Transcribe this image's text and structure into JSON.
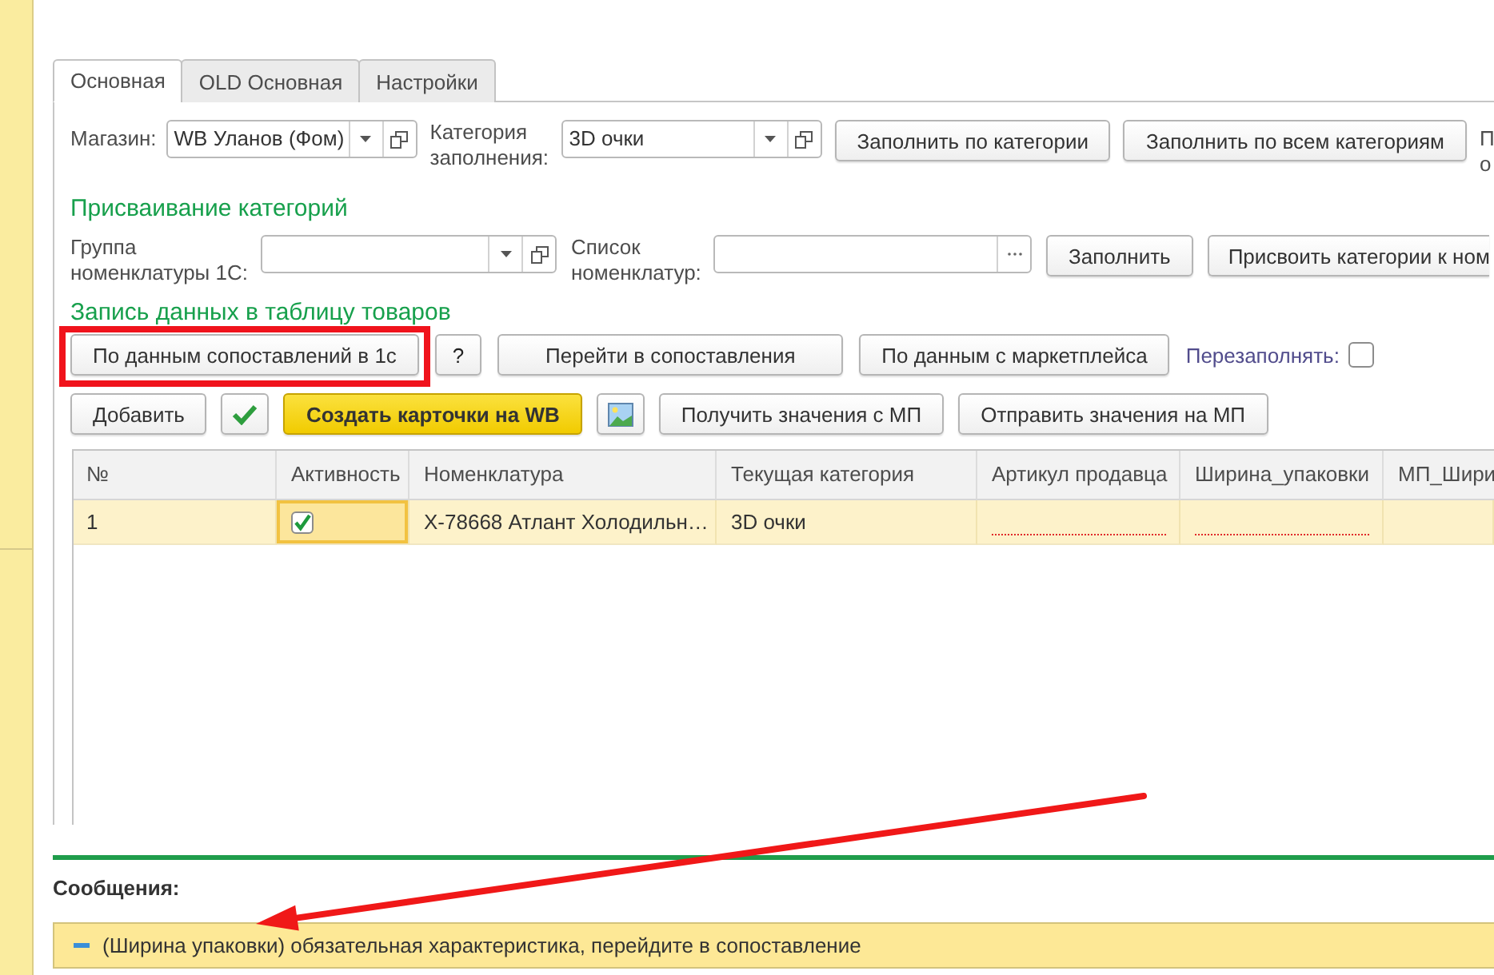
{
  "tabs": [
    {
      "label": "Основная",
      "selected": true
    },
    {
      "label": "OLD Основная",
      "selected": false
    },
    {
      "label": "Настройки",
      "selected": false
    }
  ],
  "top_row": [
    {
      "kind": "field",
      "label": "Магазин:",
      "value": "WB Уланов (Фом)",
      "controls": [
        {
          "kind": "dropdown"
        },
        {
          "kind": "open"
        }
      ]
    },
    {
      "kind": "field",
      "label": "Категория заполнения:",
      "value": "3D очки",
      "controls": [
        {
          "kind": "dropdown"
        },
        {
          "kind": "open"
        }
      ]
    },
    {
      "kind": "button",
      "label": "Заполнить по категории",
      "default": false,
      "highlighted": false
    },
    {
      "kind": "button",
      "label": "Заполнить по всем категориям",
      "default": false,
      "highlighted": false
    },
    {
      "kind": "label",
      "text": "П о"
    }
  ],
  "sections": [
    {
      "title": "Присваивание категорий",
      "rows": [
        {
          "items": [
            {
              "kind": "field",
              "label": "Группа номенклатуры 1С:",
              "controls": [
                {
                  "kind": "dropdown"
                },
                {
                  "kind": "open"
                }
              ]
            },
            {
              "kind": "field",
              "label": "Список номенклатур:",
              "controls": [
                {
                  "kind": "choose"
                }
              ]
            },
            {
              "kind": "button",
              "label": "Заполнить",
              "default": false,
              "highlighted": false
            },
            {
              "kind": "button",
              "label": "Присвоить категории к ном",
              "default": false,
              "highlighted": false
            }
          ]
        }
      ]
    },
    {
      "title": "Запись данных в таблицу товаров",
      "rows": [
        {
          "items": [
            {
              "kind": "button",
              "label": "По данным сопоставлений в 1с",
              "default": false,
              "highlighted": true
            },
            {
              "kind": "button",
              "label": "?",
              "default": false,
              "highlighted": false
            },
            {
              "kind": "button",
              "label": "Перейти в сопоставления",
              "default": false,
              "highlighted": false
            },
            {
              "kind": "button",
              "label": "По данным с маркетплейса",
              "default": false,
              "highlighted": false
            },
            {
              "kind": "checkbox",
              "label": "Перезаполнять:",
              "checked": false
            }
          ]
        },
        {
          "items": [
            {
              "kind": "button",
              "label": "Добавить",
              "default": false,
              "highlighted": false
            },
            {
              "kind": "tick"
            },
            {
              "kind": "button",
              "label": "Создать карточки на WB",
              "default": true,
              "highlighted": false
            },
            {
              "kind": "picture"
            },
            {
              "kind": "button",
              "label": "Получить значения с МП",
              "default": false,
              "highlighted": false
            },
            {
              "kind": "button",
              "label": "Отправить значения на МП",
              "default": false,
              "highlighted": false
            }
          ]
        }
      ]
    }
  ],
  "table": {
    "columns": [
      "№",
      "Активность",
      "Номенклатура",
      "Текущая категория",
      "Артикул продавца",
      "Ширина_упаковки",
      "МП_Шири"
    ],
    "rows": [
      {
        "selected": true,
        "cells": [
          {
            "kind": "text",
            "text": "1",
            "focused": false
          },
          {
            "kind": "checkbox",
            "checked": true,
            "focused": true
          },
          {
            "kind": "text",
            "text": "Х-78668 Атлант Холодильн…",
            "focused": false
          },
          {
            "kind": "text",
            "text": "3D очки",
            "focused": false
          },
          {
            "kind": "input",
            "required": true,
            "focused": false
          },
          {
            "kind": "input",
            "required": true,
            "focused": false
          },
          {
            "kind": "input",
            "required": false,
            "focused": false
          }
        ]
      }
    ]
  },
  "messages": {
    "title": "Сообщения:",
    "items": [
      {
        "text": "(Ширина упаковки) обязательная характеристика, перейдите в сопоставление",
        "pointed_at": true
      }
    ]
  }
}
